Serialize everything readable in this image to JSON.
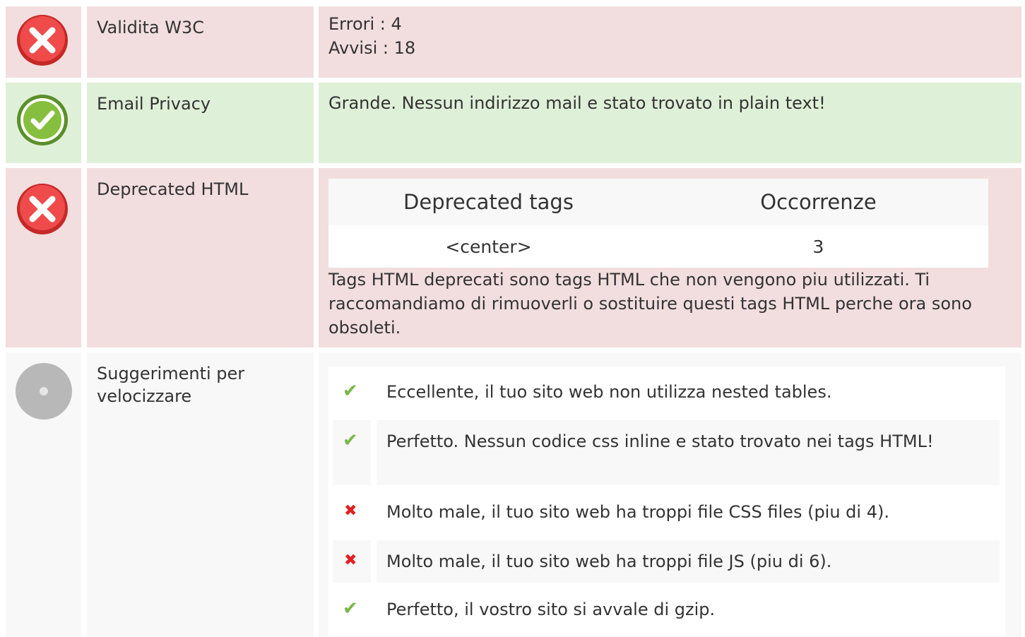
{
  "rows": [
    {
      "status": "error",
      "label": "Validita W3C",
      "lines": [
        "Errori : 4",
        "Avvisi : 18"
      ]
    },
    {
      "status": "ok",
      "label": "Email Privacy",
      "text": "Grande. Nessun indirizzo mail e stato trovato in plain text!"
    },
    {
      "status": "error",
      "label": "Deprecated HTML",
      "table": {
        "headers": [
          "Deprecated tags",
          "Occorrenze"
        ],
        "rows": [
          [
            "<center>",
            "3"
          ]
        ]
      },
      "description": "Tags HTML deprecati sono tags HTML che non vengono piu utilizzati. Ti raccomandiamo di rimuoverli o sostituire questi tags HTML perche ora sono obsoleti."
    },
    {
      "status": "neutral",
      "label": "Suggerimenti per velocizzare",
      "items": [
        {
          "status": "ok",
          "text": "Eccellente, il tuo sito web non utilizza nested tables."
        },
        {
          "status": "ok",
          "text": "Perfetto. Nessun codice css inline e stato trovato nei tags HTML!"
        },
        {
          "status": "bad",
          "text": "Molto male, il tuo sito web ha troppi file CSS files (piu di 4)."
        },
        {
          "status": "bad",
          "text": "Molto male, il tuo sito web ha troppi file JS (piu di 6)."
        },
        {
          "status": "ok",
          "text": "Perfetto, il vostro sito si avvale di gzip."
        }
      ]
    }
  ],
  "icons": {
    "error": "error-x-circle-icon",
    "ok": "check-circle-icon",
    "neutral": "neutral-dot-circle-icon",
    "item_ok": "check-mark-icon",
    "item_bad": "x-mark-icon"
  },
  "colors": {
    "error_bg": "#f2dede",
    "ok_bg": "#dff0d8",
    "neutral_bg": "#f8f8f8",
    "error_icon": "#e03a3a",
    "ok_icon": "#7ab648",
    "neutral_icon": "#b8b8b8"
  }
}
